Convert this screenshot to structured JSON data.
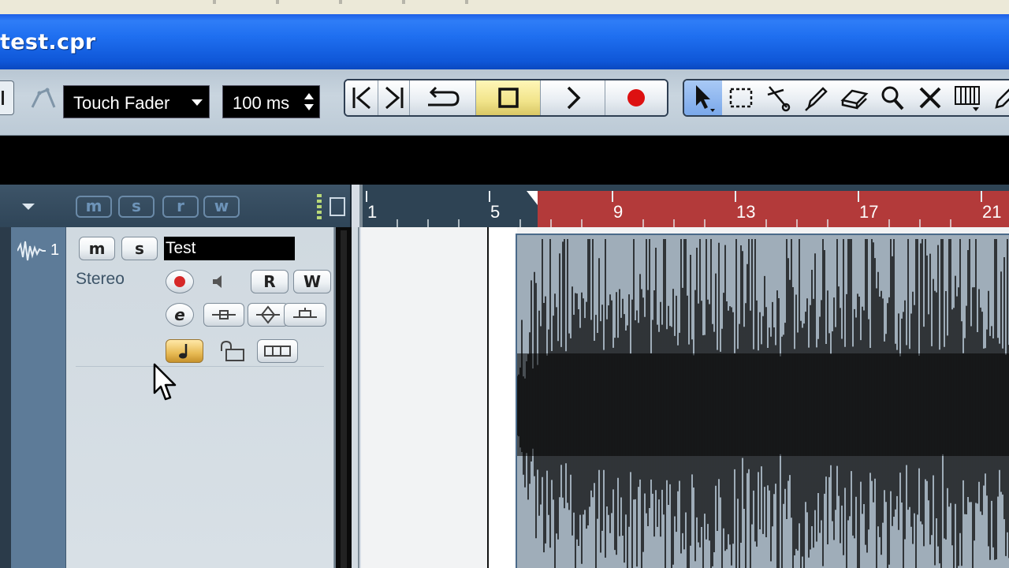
{
  "window": {
    "title": "test.cpr"
  },
  "toolbar": {
    "automation_mode": "Touch Fader",
    "automation_time": "100 ms",
    "transport": [
      {
        "name": "to-start",
        "icon": "skip-to-start-icon"
      },
      {
        "name": "to-end",
        "icon": "skip-to-end-icon"
      },
      {
        "name": "cycle",
        "icon": "cycle-icon"
      },
      {
        "name": "stop",
        "icon": "stop-icon",
        "active": true
      },
      {
        "name": "play",
        "icon": "play-icon"
      },
      {
        "name": "record",
        "icon": "record-icon"
      }
    ],
    "tools": [
      {
        "name": "object-selection",
        "icon": "pointer-icon",
        "selected": true
      },
      {
        "name": "range-selection",
        "icon": "range-select-icon"
      },
      {
        "name": "split",
        "icon": "scissors-icon"
      },
      {
        "name": "glue",
        "icon": "glue-icon"
      },
      {
        "name": "erase",
        "icon": "eraser-icon"
      },
      {
        "name": "zoom",
        "icon": "zoom-icon"
      },
      {
        "name": "mute",
        "icon": "mute-x-icon"
      },
      {
        "name": "timewarp",
        "icon": "timewarp-icon"
      },
      {
        "name": "draw",
        "icon": "pencil-icon"
      }
    ]
  },
  "tracklist_header": {
    "buttons": [
      "m",
      "s",
      "r",
      "w"
    ]
  },
  "ruler": {
    "labels": [
      "1",
      "5",
      "9",
      "13",
      "17",
      "21"
    ]
  },
  "track": {
    "number": "1",
    "name": "Test",
    "type": "Stereo",
    "mute_label": "m",
    "solo_label": "s",
    "read_label": "R",
    "write_label": "W",
    "edit_label": "e"
  },
  "colors": {
    "cycle_region": "#b33a3a",
    "ruler_bg": "#2e4354",
    "titlebar": "#1f6ff0",
    "stop_active": "#f1e48a",
    "record_red": "#dd1111"
  }
}
